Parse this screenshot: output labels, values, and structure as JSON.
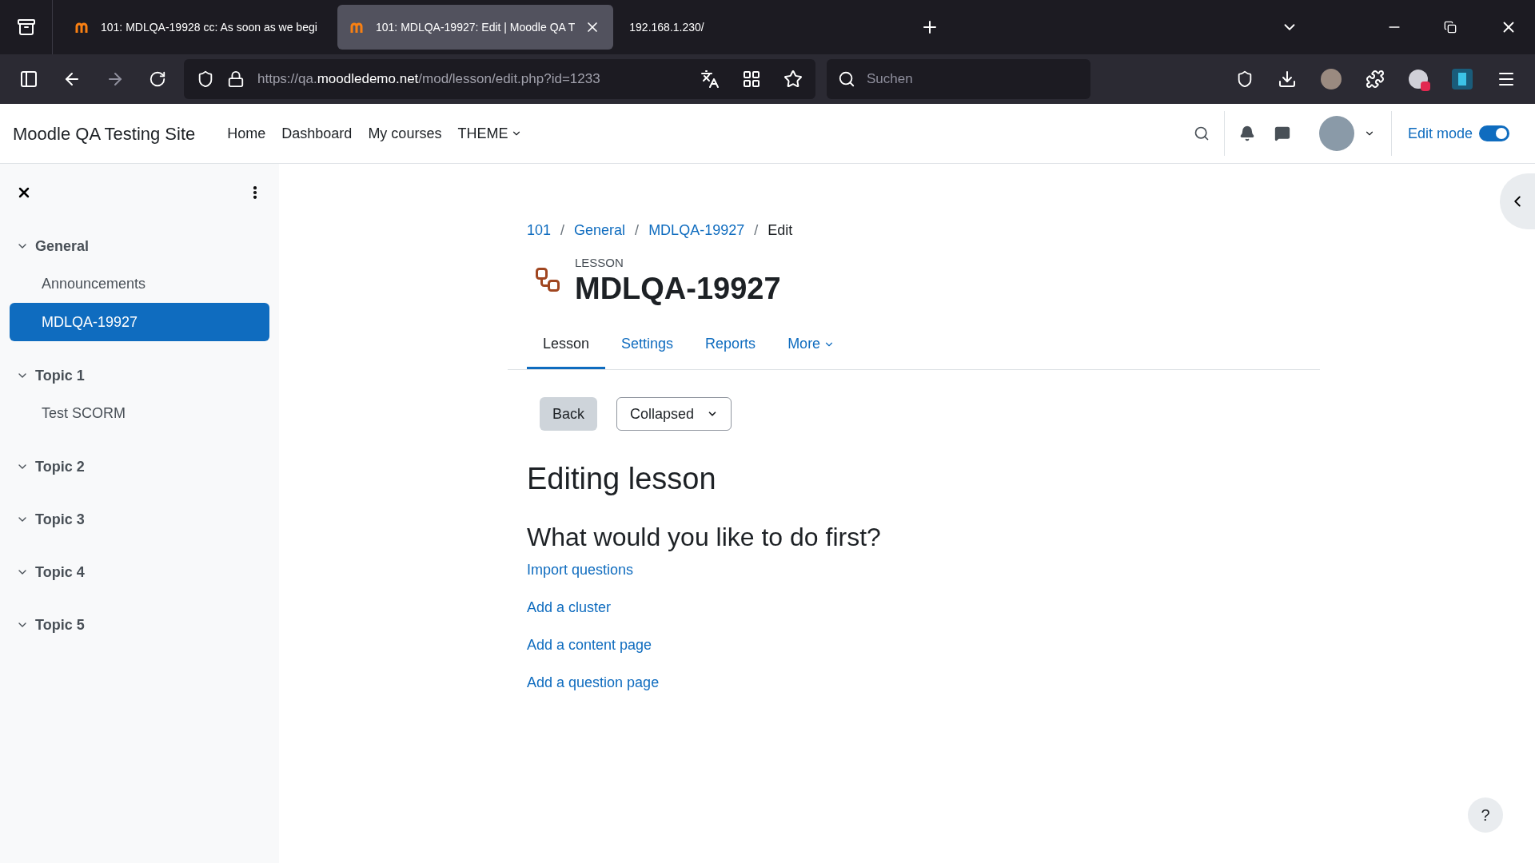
{
  "browser": {
    "tabs": [
      {
        "title": "101: MDLQA-19928 cc: As soon as we begi",
        "selected": false,
        "closable": false
      },
      {
        "title": "101: MDLQA-19927: Edit | Moodle QA T",
        "selected": true,
        "closable": true
      },
      {
        "title": "192.168.1.230/",
        "selected": false,
        "closable": false
      }
    ],
    "url": {
      "scheme": "https://qa.",
      "domain": "moodledemo.net",
      "path": "/mod/lesson/edit.php?id=1233"
    },
    "search": {
      "placeholder": "Suchen"
    }
  },
  "navbar": {
    "site_name": "Moodle QA Testing Site",
    "items": [
      {
        "label": "Home",
        "dropdown": false
      },
      {
        "label": "Dashboard",
        "dropdown": false
      },
      {
        "label": "My courses",
        "dropdown": false
      },
      {
        "label": "THEME",
        "dropdown": true
      }
    ],
    "edit_mode": {
      "label": "Edit mode",
      "on": true
    }
  },
  "sidebar": {
    "sections": [
      {
        "title": "General",
        "expanded": true,
        "children": [
          {
            "label": "Announcements",
            "selected": false
          },
          {
            "label": "MDLQA-19927",
            "selected": true
          }
        ]
      },
      {
        "title": "Topic 1",
        "expanded": true,
        "children": [
          {
            "label": "Test SCORM",
            "selected": false
          }
        ]
      },
      {
        "title": "Topic 2",
        "expanded": true
      },
      {
        "title": "Topic 3",
        "expanded": true
      },
      {
        "title": "Topic 4",
        "expanded": true
      },
      {
        "title": "Topic 5",
        "expanded": true
      }
    ]
  },
  "breadcrumb": {
    "separator": "/",
    "items": [
      "101",
      "General",
      "MDLQA-19927",
      "Edit"
    ]
  },
  "module": {
    "type_label": "LESSON",
    "title": "MDLQA-19927"
  },
  "tabs": [
    {
      "label": "Lesson",
      "selected": true,
      "dropdown": false
    },
    {
      "label": "Settings",
      "selected": false,
      "dropdown": false
    },
    {
      "label": "Reports",
      "selected": false,
      "dropdown": false
    },
    {
      "label": "More",
      "selected": false,
      "dropdown": true
    }
  ],
  "actions": {
    "back": "Back",
    "view_select": "Collapsed"
  },
  "heading": "Editing lesson",
  "subheading": "What would you like to do first?",
  "links": [
    "Import questions",
    "Add a cluster",
    "Add a content page",
    "Add a question page"
  ],
  "help_button": "?"
}
